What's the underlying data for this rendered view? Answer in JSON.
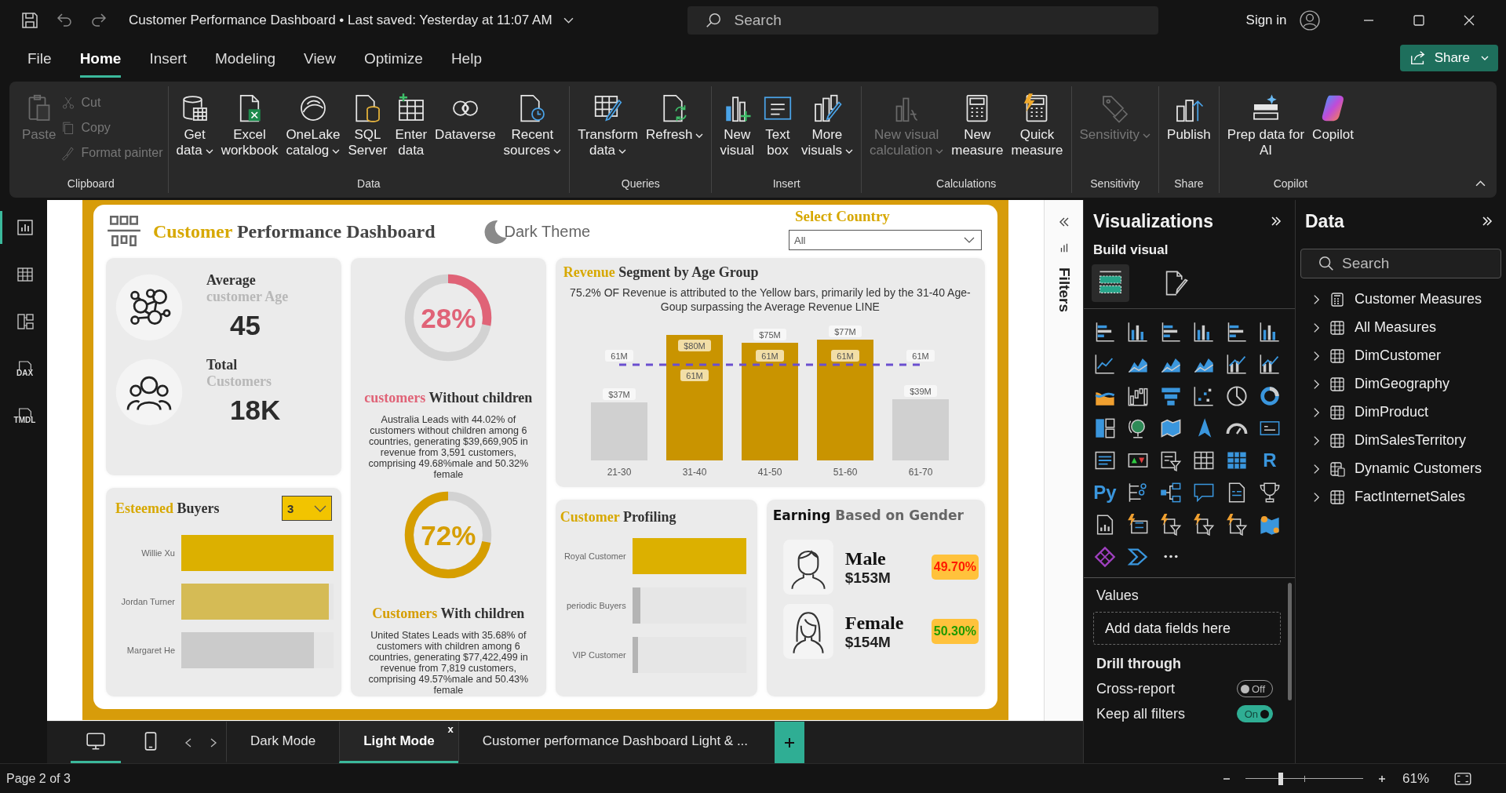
{
  "window": {
    "title": "Customer Performance Dashboard • Last saved: Yesterday at 11:07 AM",
    "search_placeholder": "Search",
    "sign_in": "Sign in"
  },
  "menu": [
    {
      "label": "File",
      "selected": false
    },
    {
      "label": "Home",
      "selected": true
    },
    {
      "label": "Insert",
      "selected": false
    },
    {
      "label": "Modeling",
      "selected": false
    },
    {
      "label": "View",
      "selected": false
    },
    {
      "label": "Optimize",
      "selected": false
    },
    {
      "label": "Help",
      "selected": false
    }
  ],
  "share": "Share",
  "ribbon": [
    {
      "name": "Clipboard",
      "buttons": [
        {
          "kind": "large",
          "lines": [
            "Paste"
          ],
          "disabled": true,
          "dropdown": false
        },
        {
          "kind": "small",
          "lines": [
            "Cut"
          ],
          "disabled": true,
          "dropdown": false
        },
        {
          "kind": "small",
          "lines": [
            "Copy"
          ],
          "disabled": true,
          "dropdown": false
        },
        {
          "kind": "small",
          "lines": [
            "Format painter"
          ],
          "disabled": true,
          "dropdown": false
        }
      ]
    },
    {
      "name": "Data",
      "buttons": [
        {
          "kind": "large",
          "lines": [
            "Get",
            "data"
          ],
          "disabled": false,
          "dropdown": true
        },
        {
          "kind": "large",
          "lines": [
            "Excel",
            "workbook"
          ],
          "disabled": false,
          "dropdown": false
        },
        {
          "kind": "large",
          "lines": [
            "OneLake",
            "catalog"
          ],
          "disabled": false,
          "dropdown": true
        },
        {
          "kind": "large",
          "lines": [
            "SQL",
            "Server"
          ],
          "disabled": false,
          "dropdown": false
        },
        {
          "kind": "large",
          "lines": [
            "Enter",
            "data"
          ],
          "disabled": false,
          "dropdown": false
        },
        {
          "kind": "large",
          "lines": [
            "Dataverse"
          ],
          "disabled": false,
          "dropdown": false
        },
        {
          "kind": "large",
          "lines": [
            "Recent",
            "sources"
          ],
          "disabled": false,
          "dropdown": true
        }
      ]
    },
    {
      "name": "Queries",
      "buttons": [
        {
          "kind": "large",
          "lines": [
            "Transform",
            "data"
          ],
          "disabled": false,
          "dropdown": true
        },
        {
          "kind": "large",
          "lines": [
            "Refresh"
          ],
          "disabled": false,
          "dropdown": true
        }
      ]
    },
    {
      "name": "Insert",
      "buttons": [
        {
          "kind": "large",
          "lines": [
            "New",
            "visual"
          ],
          "disabled": false,
          "dropdown": false
        },
        {
          "kind": "large",
          "lines": [
            "Text",
            "box"
          ],
          "disabled": false,
          "dropdown": false
        },
        {
          "kind": "large",
          "lines": [
            "More",
            "visuals"
          ],
          "disabled": false,
          "dropdown": true
        }
      ]
    },
    {
      "name": "Calculations",
      "buttons": [
        {
          "kind": "large",
          "lines": [
            "New visual",
            "calculation"
          ],
          "disabled": true,
          "dropdown": true
        },
        {
          "kind": "large",
          "lines": [
            "New",
            "measure"
          ],
          "disabled": false,
          "dropdown": false
        },
        {
          "kind": "large",
          "lines": [
            "Quick",
            "measure"
          ],
          "disabled": false,
          "dropdown": false
        }
      ]
    },
    {
      "name": "Sensitivity",
      "buttons": [
        {
          "kind": "large",
          "lines": [
            "Sensitivity"
          ],
          "disabled": true,
          "dropdown": true
        }
      ]
    },
    {
      "name": "Share",
      "buttons": [
        {
          "kind": "large",
          "lines": [
            "Publish"
          ],
          "disabled": false,
          "dropdown": false
        }
      ]
    },
    {
      "name": "Copilot",
      "buttons": [
        {
          "kind": "large",
          "lines": [
            "Prep data for",
            "AI"
          ],
          "disabled": false,
          "dropdown": false
        },
        {
          "kind": "large",
          "lines": [
            "Copilot"
          ],
          "disabled": false,
          "dropdown": false
        }
      ]
    }
  ],
  "left_nav": [
    {
      "kind": "report",
      "selected": true
    },
    {
      "kind": "table",
      "selected": false
    },
    {
      "kind": "model",
      "selected": false
    },
    {
      "kind": "dax",
      "label": "DAX",
      "selected": false
    },
    {
      "kind": "tmdl",
      "label": "TMDL",
      "selected": false
    }
  ],
  "dashboard": {
    "title": {
      "accent": "Customer",
      "rest": "Performance Dashboard"
    },
    "theme_button": "Dark Theme",
    "country": {
      "label": "Select Country",
      "value": "All"
    },
    "kpis": [
      {
        "kind": "network",
        "line1": "Average",
        "line2": "customer Age",
        "value": "45"
      },
      {
        "kind": "group",
        "line1": "Total",
        "line2": "Customers",
        "value": "18K"
      }
    ],
    "buyers": {
      "accent": "Esteemed",
      "rest": "Buyers",
      "top_n": "3",
      "bars": [
        {
          "name": "Willie Xu",
          "level": 1.0,
          "color": "#dcb000"
        },
        {
          "name": "Jordan Turner",
          "level": 0.97,
          "color": "#d5bb55"
        },
        {
          "name": "Margaret He",
          "level": 0.87,
          "color": "#cbcbcb"
        }
      ]
    },
    "children": [
      {
        "percent": "28%",
        "level": 0.28,
        "clockwise": true,
        "color": "#e06377",
        "accent": "customers",
        "rest": "Without children",
        "text": "Australia Leads with 44.02% of customers without children among 6 countries, generating $39,669,905 in revenue from 3,591 customers, comprising 49.68%male and 50.32% female"
      },
      {
        "percent": "72%",
        "level": 0.72,
        "clockwise": false,
        "color": "#d69e00",
        "accent": "Customers",
        "rest": "With children",
        "text": "United States Leads with 35.68% of customers with children among 6 countries, generating $77,422,499 in revenue from 7,819 customers, comprising 49.57%male and 50.43% female"
      }
    ],
    "revenue": {
      "accent": "Revenue",
      "rest": "Segment by Age Group",
      "note": "75.2% OF Revenue is attributed to the Yellow bars, primarily led by the 31-40 Age-Goup surpassing the Average Revenue LINE",
      "chart_data": {
        "type": "bar",
        "categories": [
          "21-30",
          "31-40",
          "41-50",
          "51-60",
          "61-70"
        ],
        "series": [
          {
            "color": "#d0d0d0",
            "values": [
              37,
              null,
              null,
              null,
              39
            ],
            "value_labels": [
              "$37M",
              null,
              null,
              null,
              "$39M"
            ]
          },
          {
            "color": "#c99400",
            "values": [
              null,
              80,
              75,
              77,
              null
            ],
            "value_labels": [
              null,
              "$80M",
              "$75M",
              "$77M",
              null
            ]
          },
          {
            "type": "line",
            "line_style": "dashed",
            "color": "#6a4fcf",
            "values": [
              61,
              61,
              61,
              61,
              61
            ],
            "value_labels": [
              "61M",
              "61M",
              "61M",
              "61M",
              "61M"
            ]
          }
        ]
      }
    },
    "profiling": {
      "accent": "Customer",
      "rest": "Profiling",
      "bars": [
        {
          "name": "Royal Customer",
          "level": 1.0,
          "color": "#dcb000"
        },
        {
          "name": "periodic Buyers",
          "level": 0.07,
          "color": "#b4b4b4"
        },
        {
          "name": "VIP Customer",
          "level": 0.05,
          "color": "#b4b4b4"
        }
      ]
    },
    "gender": {
      "bold": "Earning",
      "rest": "Based on Gender",
      "rows": [
        {
          "kind": "male",
          "label": "Male",
          "amount": "$153M",
          "share": "49.70%",
          "color": "#ff1a00"
        },
        {
          "kind": "female",
          "label": "Female",
          "amount": "$154M",
          "share": "50.30%",
          "color": "#1f9a00"
        }
      ]
    }
  },
  "filters": {
    "label": "Filters"
  },
  "visualizations": {
    "title": "Visualizations",
    "build_visual": "Build visual",
    "tabs": [
      {
        "kind": "build",
        "selected": true
      },
      {
        "kind": "format",
        "selected": false
      }
    ],
    "script_visuals": [
      "R",
      "Py"
    ],
    "values": "Values",
    "drop_hint": "Add data fields here",
    "drill": "Drill through",
    "toggles": [
      {
        "label": "Cross-report",
        "on": false,
        "state_label": "Off"
      },
      {
        "label": "Keep all filters",
        "on": true,
        "state_label": "On"
      }
    ]
  },
  "data": {
    "title": "Data",
    "search_placeholder": "Search",
    "items": [
      {
        "label": "Customer Measures",
        "kind": "measures",
        "expanded": false
      },
      {
        "label": "All Measures",
        "kind": "table",
        "expanded": false
      },
      {
        "label": "DimCustomer",
        "kind": "table",
        "expanded": false
      },
      {
        "label": "DimGeography",
        "kind": "table",
        "expanded": false
      },
      {
        "label": "DimProduct",
        "kind": "table",
        "expanded": false
      },
      {
        "label": "DimSalesTerritory",
        "kind": "table",
        "expanded": false
      },
      {
        "label": "Dynamic Customers",
        "kind": "calculated",
        "expanded": false
      },
      {
        "label": "FactInternetSales",
        "kind": "table",
        "expanded": false
      }
    ]
  },
  "page_bar": {
    "views": [
      {
        "kind": "desktop",
        "selected": true
      },
      {
        "kind": "mobile",
        "selected": false
      }
    ],
    "tabs": [
      {
        "label": "Dark Mode",
        "selected": false
      },
      {
        "label": "Light Mode",
        "selected": true,
        "close": "x"
      },
      {
        "label": "Customer performance Dashboard Light & ...",
        "selected": false
      }
    ]
  },
  "status": {
    "page": "Page 2 of 3",
    "zoom": "61%",
    "level": 0.3
  }
}
